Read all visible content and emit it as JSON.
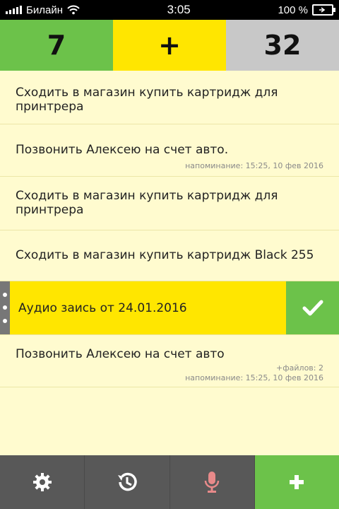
{
  "status": {
    "carrier": "Билайн",
    "time": "3:05",
    "battery": "100 %"
  },
  "counters": {
    "left": "7",
    "middle": "+",
    "right": "32"
  },
  "tasks": [
    {
      "title": "Сходить в магазин купить картридж для принтрера",
      "meta1": "",
      "meta2": ""
    },
    {
      "title": "Позвонить Алексею на счет авто.",
      "meta1": "напоминание: 15:25, 10 фев 2016",
      "meta2": ""
    },
    {
      "title": "Сходить в магазин купить картридж для принтрера",
      "meta1": "",
      "meta2": ""
    },
    {
      "title": "Сходить в магазин купить картридж Black 255",
      "meta1": "",
      "meta2": ""
    },
    {
      "title": "Аудио заись от 24.01.2016",
      "meta1": "",
      "meta2": "",
      "selected": true
    },
    {
      "title": "Позвонить Алексею на счет авто",
      "meta1": "+файлов: 2",
      "meta2": "напоминание: 15:25, 10 фев 2016"
    }
  ],
  "toolbar": {
    "icons": [
      "gear-icon",
      "history-icon",
      "microphone-icon",
      "plus-icon"
    ]
  },
  "colors": {
    "green": "#6CC24A",
    "yellow": "#FFE600",
    "gray": "#C8C8C8",
    "background": "#FFFBCF",
    "toolbar": "#585858",
    "mic": "#E88A8A"
  }
}
